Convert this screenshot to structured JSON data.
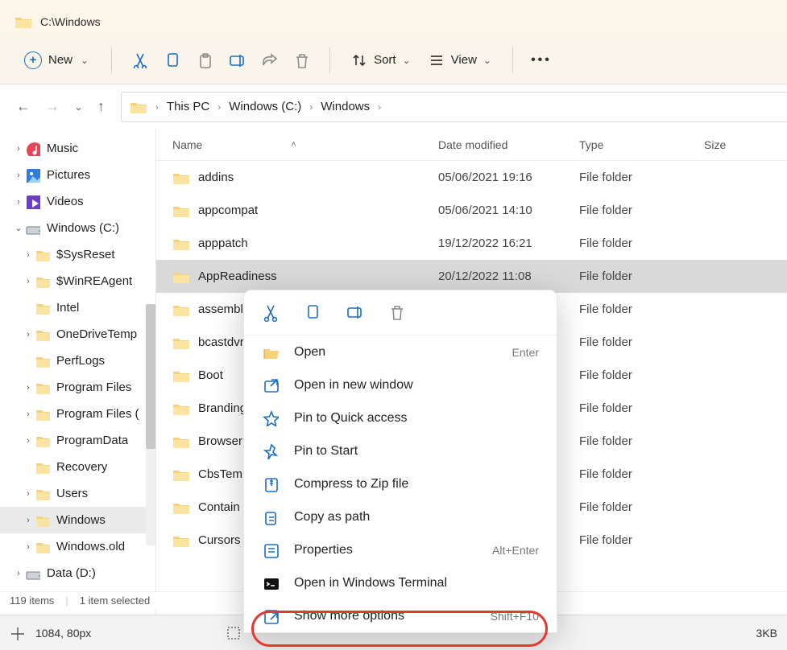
{
  "title": "C:\\Windows",
  "toolbar": {
    "new_label": "New",
    "sort_label": "Sort",
    "view_label": "View"
  },
  "breadcrumb": [
    "This PC",
    "Windows (C:)",
    "Windows"
  ],
  "columns": {
    "name": "Name",
    "date": "Date modified",
    "type": "Type",
    "size": "Size"
  },
  "sidebar": [
    {
      "label": "Music",
      "icon": "music",
      "ind": 0,
      "exp": ">"
    },
    {
      "label": "Pictures",
      "icon": "pictures",
      "ind": 0,
      "exp": ">"
    },
    {
      "label": "Videos",
      "icon": "videos",
      "ind": 0,
      "exp": ">"
    },
    {
      "label": "Windows (C:)",
      "icon": "drive",
      "ind": 0,
      "exp": "v"
    },
    {
      "label": "$SysReset",
      "icon": "folder",
      "ind": 1,
      "exp": ">"
    },
    {
      "label": "$WinREAgent",
      "icon": "folder",
      "ind": 1,
      "exp": ">"
    },
    {
      "label": "Intel",
      "icon": "folder",
      "ind": 1,
      "exp": ""
    },
    {
      "label": "OneDriveTemp",
      "icon": "folder",
      "ind": 1,
      "exp": ">"
    },
    {
      "label": "PerfLogs",
      "icon": "folder",
      "ind": 1,
      "exp": ""
    },
    {
      "label": "Program Files",
      "icon": "folder",
      "ind": 1,
      "exp": ">"
    },
    {
      "label": "Program Files (",
      "icon": "folder",
      "ind": 1,
      "exp": ">"
    },
    {
      "label": "ProgramData",
      "icon": "folder",
      "ind": 1,
      "exp": ">"
    },
    {
      "label": "Recovery",
      "icon": "folder",
      "ind": 1,
      "exp": ""
    },
    {
      "label": "Users",
      "icon": "folder",
      "ind": 1,
      "exp": ">"
    },
    {
      "label": "Windows",
      "icon": "folder",
      "ind": 1,
      "exp": ">",
      "active": true
    },
    {
      "label": "Windows.old",
      "icon": "folder",
      "ind": 1,
      "exp": ">"
    },
    {
      "label": "Data (D:)",
      "icon": "drive",
      "ind": 0,
      "exp": ">"
    }
  ],
  "rows": [
    {
      "name": "addins",
      "date": "05/06/2021 19:16",
      "type": "File folder"
    },
    {
      "name": "appcompat",
      "date": "05/06/2021 14:10",
      "type": "File folder"
    },
    {
      "name": "apppatch",
      "date": "19/12/2022 16:21",
      "type": "File folder"
    },
    {
      "name": "AppReadiness",
      "date": "20/12/2022 11:08",
      "type": "File folder",
      "selected": true
    },
    {
      "name": "assembl",
      "date": "",
      "type": "File folder"
    },
    {
      "name": "bcastdvr",
      "date": "",
      "type": "File folder"
    },
    {
      "name": "Boot",
      "date": "",
      "type": "File folder"
    },
    {
      "name": "Branding",
      "date": "",
      "type": "File folder"
    },
    {
      "name": "Browser",
      "date": "",
      "type": "File folder"
    },
    {
      "name": "CbsTem",
      "date": "",
      "type": "File folder"
    },
    {
      "name": "Contain",
      "date": "",
      "type": "File folder"
    },
    {
      "name": "Cursors",
      "date": "",
      "type": "File folder"
    }
  ],
  "context_menu": [
    {
      "label": "Open",
      "shortcut": "Enter",
      "icon": "folder-open"
    },
    {
      "label": "Open in new window",
      "shortcut": "",
      "icon": "open-window"
    },
    {
      "label": "Pin to Quick access",
      "shortcut": "",
      "icon": "star"
    },
    {
      "label": "Pin to Start",
      "shortcut": "",
      "icon": "pin"
    },
    {
      "label": "Compress to Zip file",
      "shortcut": "",
      "icon": "zip"
    },
    {
      "label": "Copy as path",
      "shortcut": "",
      "icon": "copy-path"
    },
    {
      "label": "Properties",
      "shortcut": "Alt+Enter",
      "icon": "properties"
    },
    {
      "label": "Open in Windows Terminal",
      "shortcut": "",
      "icon": "terminal"
    },
    {
      "label": "Show more options",
      "shortcut": "Shift+F10",
      "icon": "more",
      "highlight": true
    }
  ],
  "status": {
    "count": "119 items",
    "selection": "1 item selected"
  },
  "ruler": {
    "coords": "1084, 80px",
    "size": "3KB"
  }
}
